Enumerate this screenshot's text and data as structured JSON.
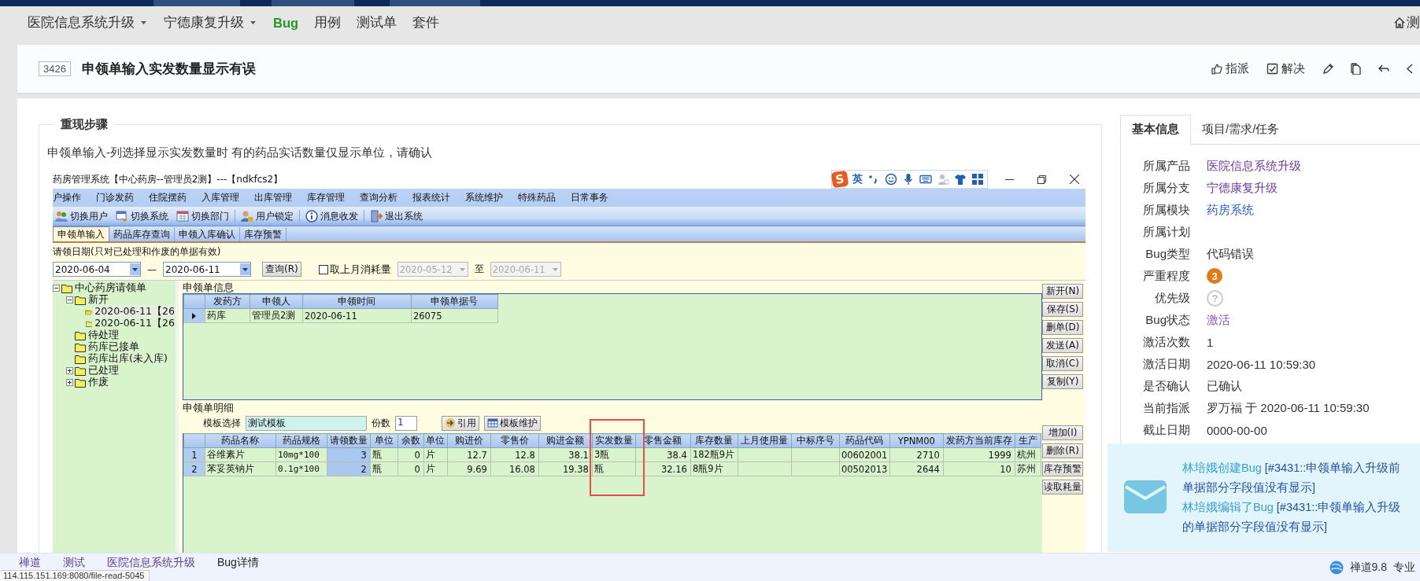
{
  "top_nav": {
    "items": [
      {
        "label": "医院信息系统升级",
        "kind": "dropdown",
        "selected": false
      },
      {
        "label": "宁德康复升级",
        "kind": "dropdown",
        "selected": false
      },
      {
        "label": "Bug",
        "kind": "link",
        "selected": true
      },
      {
        "label": "用例",
        "kind": "link",
        "selected": false
      },
      {
        "label": "测试单",
        "kind": "link",
        "selected": false
      },
      {
        "label": "套件",
        "kind": "link",
        "selected": false
      }
    ],
    "home_label": "测"
  },
  "bug": {
    "id": "3426",
    "title": "申领单输入实发数量显示有误",
    "actions": [
      {
        "kind": "assign",
        "label": "指派"
      },
      {
        "kind": "resolve",
        "label": "解决"
      },
      {
        "kind": "edit"
      },
      {
        "kind": "copy"
      },
      {
        "kind": "back"
      },
      {
        "kind": "prev"
      }
    ]
  },
  "steps": {
    "heading": "重现步骤",
    "text": "申领单输入-列选择显示实发数量时 有的药品实话数量仅显示单位，请确认",
    "screenshot": {
      "window_title": "药房管理系统【中心药房--管理员2测】---【ndkfcs2】",
      "ime": {
        "logo": "S",
        "mode": "英"
      },
      "menu": [
        "户操作",
        "门诊发药",
        "住院摆药",
        "入库管理",
        "出库管理",
        "库存管理",
        "查询分析",
        "报表统计",
        "系统维护",
        "特殊药品",
        "日常事务"
      ],
      "toolbar": [
        {
          "kind": "users",
          "label": "切换用户"
        },
        {
          "kind": "switch",
          "label": "切换系统"
        },
        {
          "kind": "dept",
          "label": "切换部门"
        },
        {
          "kind": "lock",
          "label": "用户锁定"
        },
        {
          "kind": "message",
          "label": "消息收发"
        },
        {
          "kind": "exit",
          "label": "退出系统"
        }
      ],
      "tabs": [
        {
          "label": "申领单输入",
          "selected": true
        },
        {
          "label": "药品库存查询",
          "selected": false
        },
        {
          "label": "申领入库确认",
          "selected": false
        },
        {
          "label": "库存预警",
          "selected": false
        }
      ],
      "date_filter": {
        "label": "请领日期(只对已处理和作废的单据有效)",
        "from": "2020-06-04",
        "dash": "—",
        "to": "2020-06-11",
        "query_button": "查询(R)",
        "checkbox": {
          "label": "取上月消耗量",
          "checked": false
        },
        "range_from": "2020-05-12",
        "range_sep": "至",
        "range_to": "2020-06-11",
        "range_disabled": true
      },
      "tree": [
        {
          "label": "中心药房请领单",
          "expanded": true,
          "selected": false,
          "children": [
            {
              "label": "新开",
              "expanded": true,
              "selected": false,
              "children": [
                {
                  "label": "2020-06-11【26",
                  "selected": true
                },
                {
                  "label": "2020-06-11【26",
                  "selected": false
                }
              ]
            },
            {
              "label": "待处理",
              "selected": false
            },
            {
              "label": "药库已接单",
              "selected": false
            },
            {
              "label": "药库出库(未入库)",
              "selected": false
            },
            {
              "label": "已处理",
              "expanded": false,
              "selected": false
            },
            {
              "label": "作废",
              "expanded": false,
              "selected": false
            }
          ]
        }
      ],
      "info_group": {
        "title": "申领单信息",
        "columns": [
          "发药方",
          "申领人",
          "申领时间",
          "申领单据号"
        ],
        "rows": [
          {
            "current": true,
            "cells": [
              "药库",
              "管理员2测",
              "2020-06-11",
              "26075"
            ]
          }
        ]
      },
      "detail_group": {
        "title": "申领单明细",
        "template_label": "模板选择",
        "template_value": "测试模板",
        "copies_label": "份数",
        "copies_value": "1",
        "buttons": [
          {
            "kind": "use",
            "label": "引用"
          },
          {
            "kind": "template",
            "label": "模板维护"
          }
        ],
        "columns": [
          {
            "label": "药品名称",
            "kind": "text",
            "editable": false
          },
          {
            "label": "药品规格",
            "kind": "code",
            "editable": false
          },
          {
            "label": "请领数量",
            "kind": "number",
            "editable": true
          },
          {
            "label": "单位",
            "kind": "text",
            "editable": false
          },
          {
            "label": "余数",
            "kind": "number",
            "editable": false
          },
          {
            "label": "单位",
            "kind": "text",
            "editable": false
          },
          {
            "label": "购进价",
            "kind": "number",
            "editable": false
          },
          {
            "label": "零售价",
            "kind": "number",
            "editable": false
          },
          {
            "label": "购进金额",
            "kind": "number",
            "editable": false
          },
          {
            "label": "实发数量",
            "kind": "text",
            "editable": false
          },
          {
            "label": "零售金额",
            "kind": "number",
            "editable": false
          },
          {
            "label": "库存数量",
            "kind": "text",
            "editable": false
          },
          {
            "label": "上月使用量",
            "kind": "text",
            "editable": false
          },
          {
            "label": "中标序号",
            "kind": "text",
            "editable": false
          },
          {
            "label": "药品代码",
            "kind": "text",
            "editable": false
          },
          {
            "label": "YPNM00",
            "kind": "number",
            "editable": false
          },
          {
            "label": "发药方当前库存",
            "kind": "number",
            "editable": false
          },
          {
            "label": "生产",
            "kind": "text",
            "editable": false
          }
        ],
        "rows": [
          {
            "number": "1",
            "cells": [
              "谷维素片",
              "10mg*100",
              "3",
              "瓶",
              "0",
              "片",
              "12.7",
              "12.8",
              "38.1",
              "3瓶",
              "38.4",
              "182瓶9片",
              null,
              null,
              "00602001",
              "2710",
              "1999",
              "杭州"
            ]
          },
          {
            "number": "2",
            "cells": [
              "苯妥英钠片",
              "0.1g*100",
              "2",
              "瓶",
              "0",
              "片",
              "9.69",
              "16.08",
              "19.38",
              "瓶",
              "32.16",
              "8瓶9片",
              null,
              null,
              "00502013",
              "2644",
              "10",
              "苏州"
            ]
          }
        ]
      },
      "side_buttons_top": [
        "新开(N)",
        "保存(S)",
        "删单(D)",
        "发送(A)",
        "取消(C)",
        "复制(Y)"
      ],
      "side_buttons_bottom": [
        "增加(I)",
        "删除(R)",
        "库存预警",
        "读取耗量"
      ]
    }
  },
  "side_panel": {
    "tabs": [
      {
        "label": "基本信息",
        "selected": true
      },
      {
        "label": "项目/需求/任务",
        "selected": false
      }
    ],
    "fields": [
      {
        "label": "所属产品",
        "kind": "link",
        "value": "医院信息系统升级",
        "visited": true
      },
      {
        "label": "所属分支",
        "kind": "link",
        "value": "宁德康复升级",
        "visited": true
      },
      {
        "label": "所属模块",
        "kind": "link",
        "value": "药房系统",
        "visited": false
      },
      {
        "label": "所属计划",
        "kind": "text"
      },
      {
        "label": "Bug类型",
        "kind": "text",
        "value": "代码错误"
      },
      {
        "label": "严重程度",
        "kind": "severity",
        "value": "3"
      },
      {
        "label": "优先级",
        "kind": "priority",
        "value": "?"
      },
      {
        "label": "Bug状态",
        "kind": "status",
        "value": "激活"
      },
      {
        "label": "激活次数",
        "kind": "text",
        "value": "1"
      },
      {
        "label": "激活日期",
        "kind": "text",
        "value": "2020-06-11 10:59:30"
      },
      {
        "label": "是否确认",
        "kind": "text",
        "value": "已确认"
      },
      {
        "label": "当前指派",
        "kind": "text",
        "value": "罗万福 于 2020-06-11 10:59:30"
      },
      {
        "label": "截止日期",
        "kind": "text",
        "value": "0000-00-00"
      }
    ]
  },
  "notification": {
    "messages": [
      {
        "actor": "林培娥创建Bug",
        "lines": [
          "[#3431::申领单输入升级前",
          "单据部分字段值没有显示]"
        ]
      },
      {
        "actor": "林培娥编辑了Bug",
        "lines": [
          "[#3431::申领单输入升级",
          "的单据部分字段值没有显示]"
        ]
      }
    ]
  },
  "footer": {
    "breadcrumb": [
      "禅道",
      "测试",
      "医院信息系统升级",
      "Bug详情"
    ],
    "status_url": "114.115.151.169:8080/file-read-5045",
    "version": "禅道9.8",
    "edition": "专业"
  }
}
